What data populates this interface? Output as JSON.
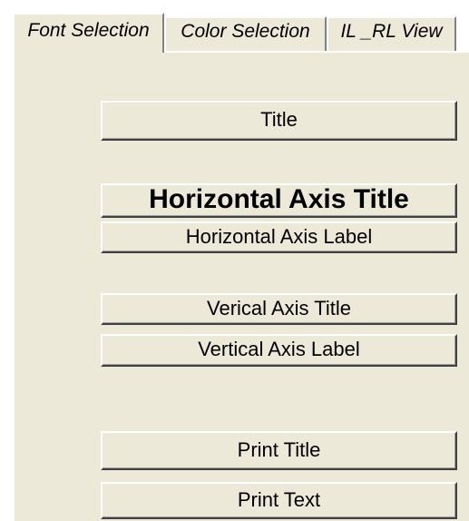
{
  "tabs": [
    {
      "label": "Font Selection",
      "active": true
    },
    {
      "label": "Color Selection",
      "active": false
    },
    {
      "label": "IL _RL View",
      "active": false
    }
  ],
  "buttons": {
    "title": "Title",
    "horizontal_axis_title": "Horizontal Axis Title",
    "horizontal_axis_label": "Horizontal Axis Label",
    "vertical_axis_title": "Verical Axis Title",
    "vertical_axis_label": "Vertical Axis Label",
    "print_title": "Print Title",
    "print_text": "Print Text"
  },
  "colors": {
    "panel_background": "#ece9d8",
    "highlight": "#ffffff",
    "shadow": "#404040"
  }
}
